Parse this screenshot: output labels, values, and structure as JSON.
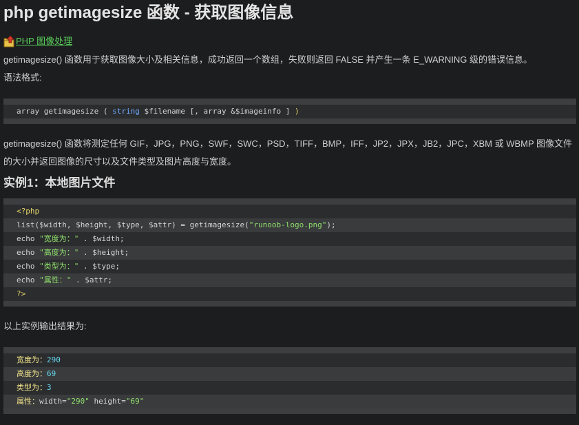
{
  "title": "php getimagesize 函数 - 获取图像信息",
  "breadcrumb": {
    "icon": "up-arrow-folder-icon",
    "label": "PHP 图像处理"
  },
  "intro": "getimagesize() 函数用于获取图像大小及相关信息，成功返回一个数组，失败则返回 FALSE 并产生一条 E_WARNING 级的错误信息。",
  "syntax_label": "语法格式:",
  "syntax": {
    "a": "array getimagesize ( ",
    "b": "string",
    "c": " $filename [, array &$imageinfo ] ",
    "d": ")"
  },
  "description": "getimagesize() 函数将测定任何 GIF，JPG，PNG，SWF，SWC，PSD，TIFF，BMP，IFF，JP2，JPX，JB2，JPC，XBM 或 WBMP 图像文件的大小并返回图像的尺寸以及文件类型及图片高度与宽度。",
  "example_title": "实例1：本地图片文件",
  "example": {
    "l1": "<?php",
    "l2a": "list($width, $height, $type, $attr) = getimagesize(",
    "l2b": "\"runoob-logo.png\"",
    "l2c": ");",
    "l3a": "echo ",
    "l3b": "\"宽度为：\"",
    "l3c": " . $width;",
    "l4a": "echo ",
    "l4b": "\"高度为：\"",
    "l4c": " . $height;",
    "l5a": "echo ",
    "l5b": "\"类型为：\"",
    "l5c": " . $type;",
    "l6a": "echo ",
    "l6b": "\"属性：\"",
    "l6c": " . $attr;",
    "l7": "?>"
  },
  "output_label": "以上实例输出结果为:",
  "output": {
    "o1a": "宽度为：",
    "o1b": "290",
    "o2a": "高度为：",
    "o2b": "69",
    "o3a": "类型为：",
    "o3b": "3",
    "o4a": "属性：",
    "o4b": "width=",
    "o4c": "\"290\"",
    "o4d": " height=",
    "o4e": "\"69\""
  }
}
